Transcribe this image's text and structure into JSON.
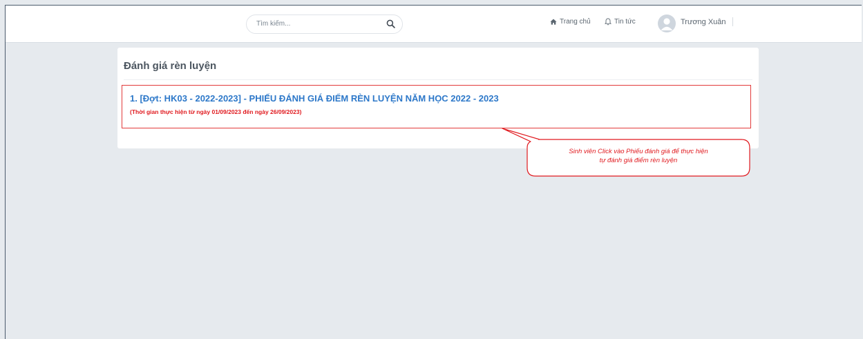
{
  "search": {
    "placeholder": "Tìm kiếm...",
    "icon": "search-icon"
  },
  "nav": {
    "home_label": "Trang chủ",
    "home_icon": "home-icon",
    "news_label": "Tin tức",
    "news_icon": "bell-icon",
    "user_name": "Trương Xuân",
    "avatar_icon": "user-avatar-icon"
  },
  "page": {
    "title": "Đánh giá rèn luyện",
    "items": [
      {
        "title": "1. [Đợt: HK03 - 2022-2023] - PHIẾU ĐÁNH GIÁ ĐIỂM RÈN LUYỆN NĂM HỌC 2022 - 2023",
        "subtitle": "(Thời gian thực hiện từ ngày 01/09/2023 đến ngày 26/09/2023)"
      }
    ]
  },
  "callout": {
    "line1": "Sinh viên Click vào Phiếu đánh giá để thực hiện",
    "line2": "tự đánh giá điểm rèn luyện"
  },
  "colors": {
    "accent_blue": "#2d78c9",
    "highlight_red": "#e0191e",
    "background": "#e6eaee"
  }
}
